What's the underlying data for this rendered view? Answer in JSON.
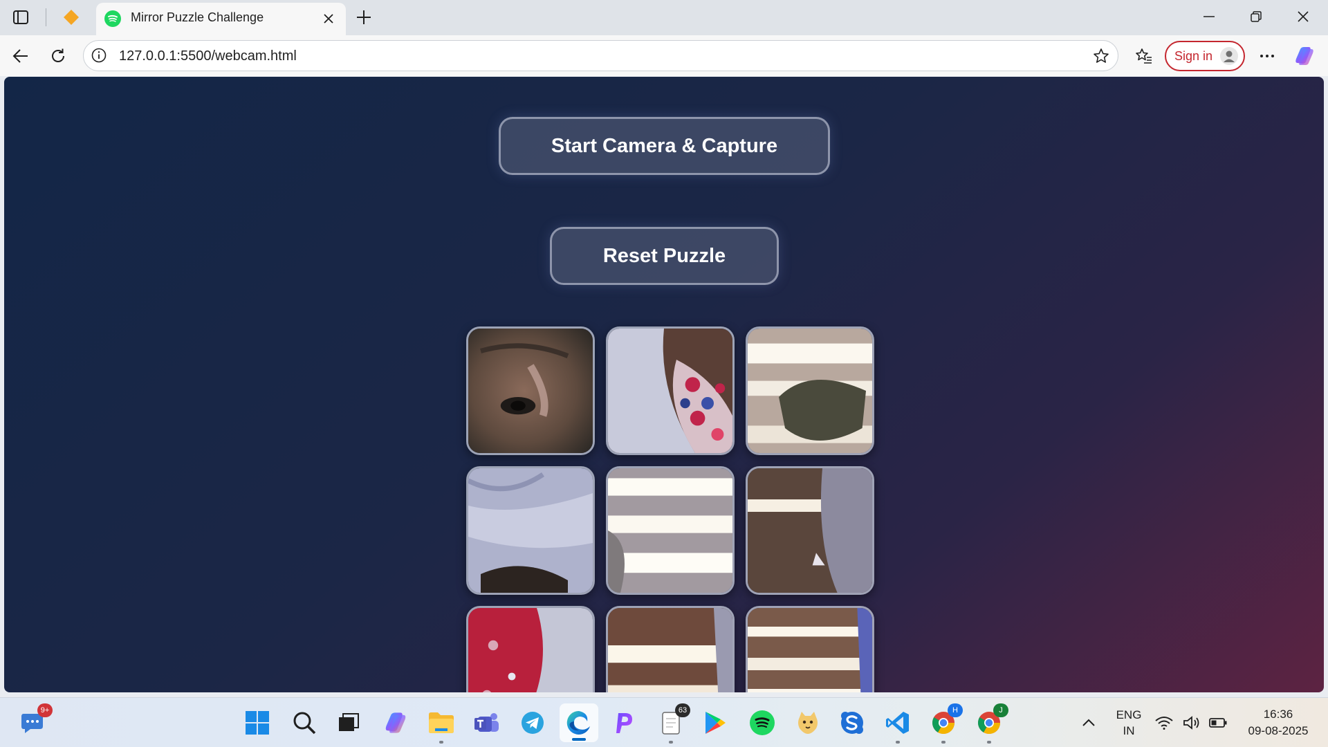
{
  "browser": {
    "tab_title": "Mirror Puzzle Challenge",
    "address_url": "127.0.0.1:5500/webcam.html",
    "signin_label": "Sign in"
  },
  "page": {
    "start_button": "Start Camera & Capture",
    "reset_button": "Reset Puzzle"
  },
  "taskbar": {
    "chat_badge": "9+",
    "notepad_badge": "63",
    "chrome_profile_1": "H",
    "chrome_profile_2": "J",
    "language_line1": "ENG",
    "language_line2": "IN",
    "time": "16:36",
    "date": "09-08-2025"
  },
  "colors": {
    "accent": "#0067c0",
    "signin_red": "#c4262e",
    "page_bg_start": "#132647",
    "page_bg_end": "#5d2342"
  }
}
